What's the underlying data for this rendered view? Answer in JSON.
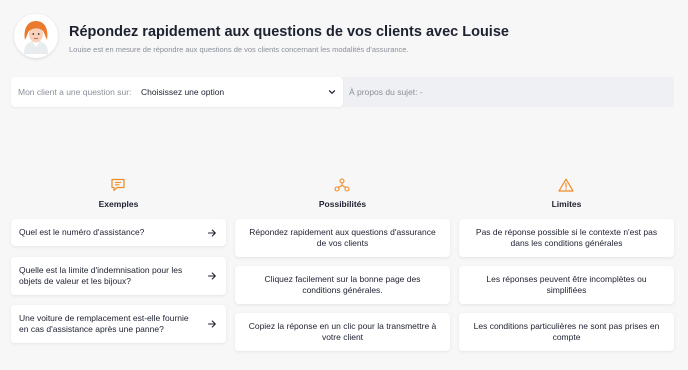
{
  "header": {
    "title": "Répondez rapidement aux questions de vos clients avec Louise",
    "subtitle": "Louise est en mesure de répondre aux questions de vos clients concernant les modalités d'assurance."
  },
  "question_bar": {
    "select_label": "Mon client a une question sur:",
    "select_value": "Choisissez une option",
    "about_label": "À propos du sujet:",
    "about_value": "-"
  },
  "columns": {
    "examples": {
      "title": "Exemples",
      "icon": "message-icon",
      "items": [
        "Quel est le numéro d'assistance?",
        "Quelle est la limite d'indemnisation pour les objets de valeur et les bijoux?",
        "Une voiture de remplacement est-elle fournie en cas d'assistance après une panne?"
      ]
    },
    "possibilities": {
      "title": "Possibilités",
      "icon": "network-icon",
      "items": [
        "Répondez rapidement aux questions d'assurance de vos clients",
        "Cliquez facilement sur la bonne page des conditions générales.",
        "Copiez la réponse en un clic pour la transmettre à votre client"
      ]
    },
    "limits": {
      "title": "Limites",
      "icon": "warning-icon",
      "items": [
        "Pas de réponse possible si le contexte n'est pas dans les conditions générales",
        "Les réponses peuvent être incomplètes ou simplifiées",
        "Les conditions particulières ne sont pas prises en compte"
      ]
    }
  },
  "colors": {
    "accent": "#f08a24",
    "background": "#f7f7f8",
    "text": "#1d2130",
    "muted": "#8a8f99"
  }
}
